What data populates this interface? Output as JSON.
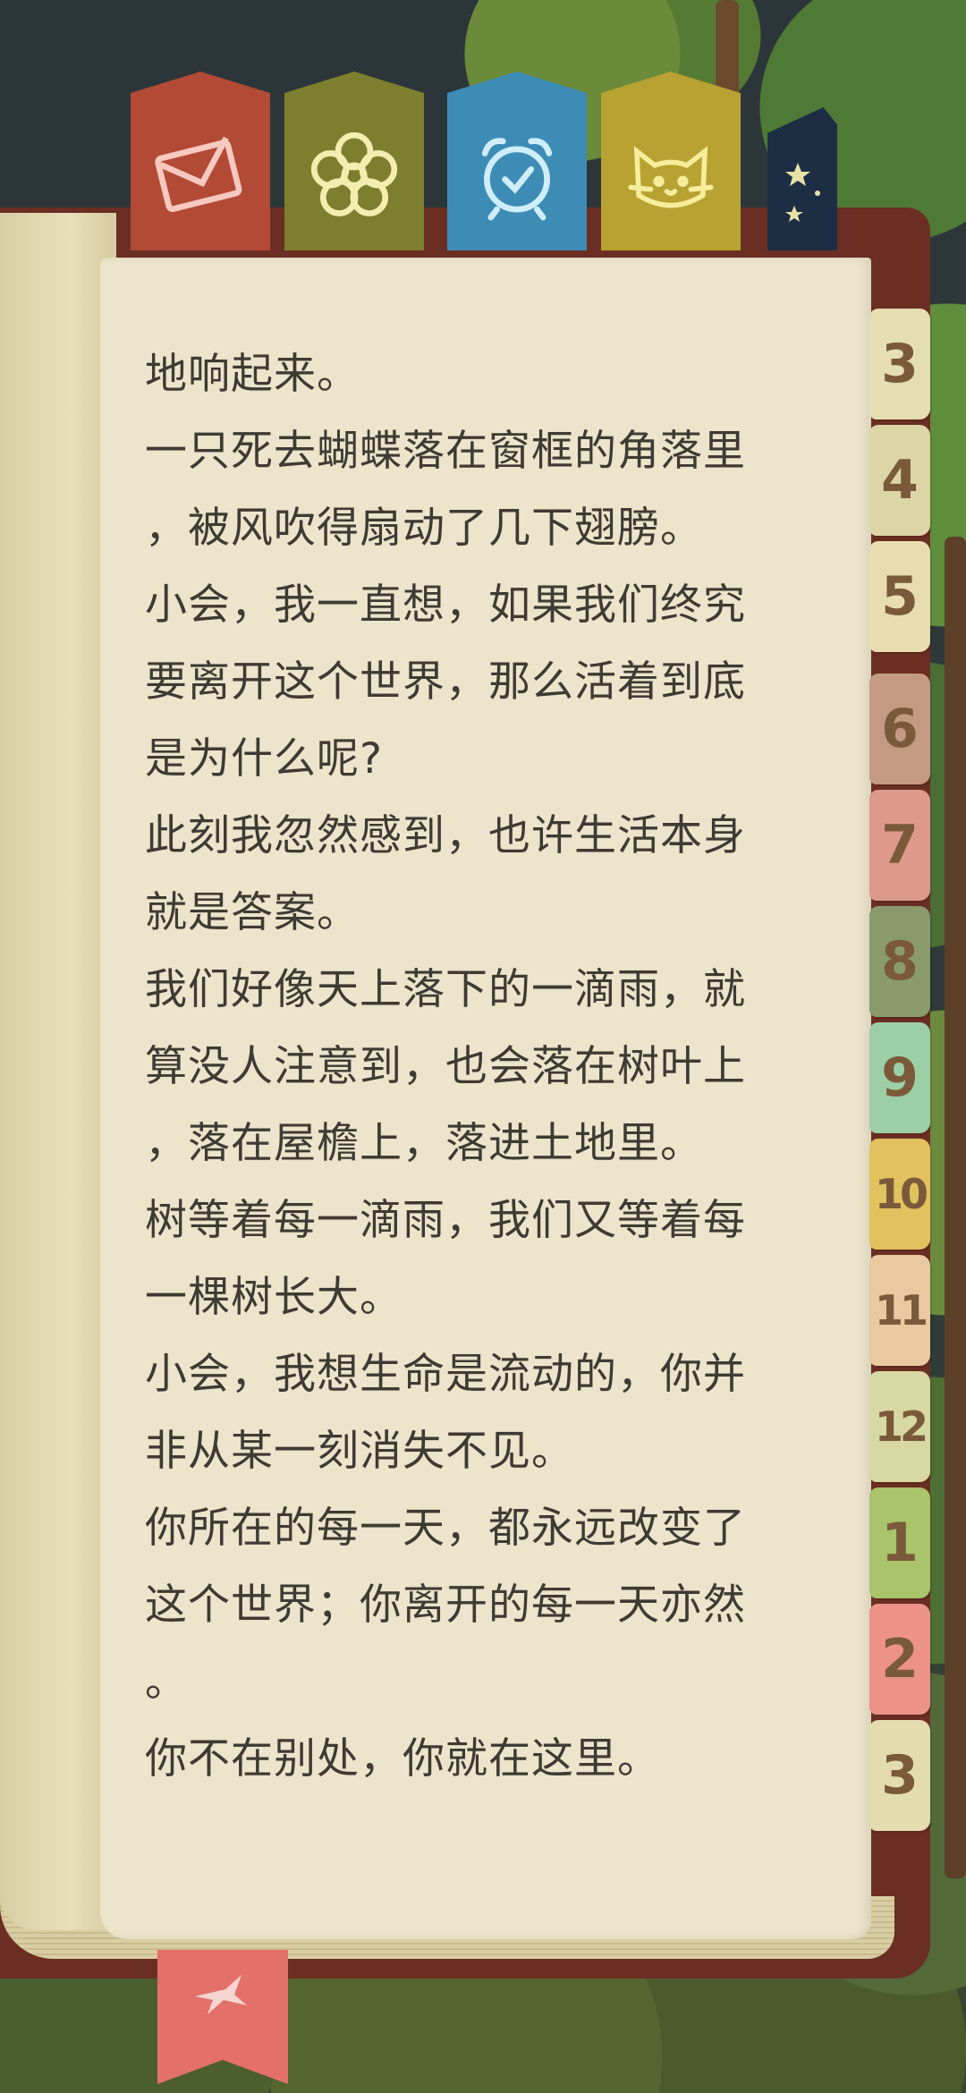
{
  "ribbons": [
    {
      "name": "envelope",
      "icon": "envelope-icon",
      "color": "#b24a35"
    },
    {
      "name": "flower",
      "icon": "flower-icon",
      "color": "#7d7f2e"
    },
    {
      "name": "alarm-clock",
      "icon": "alarm-clock-icon",
      "color": "#3d8cb6"
    },
    {
      "name": "cat",
      "icon": "cat-icon",
      "color": "#b8a232"
    },
    {
      "name": "stars",
      "icon": "stars-icon",
      "color": "#1d2d44"
    }
  ],
  "text_lines": [
    "地响起来。",
    "一只死去蝴蝶落在窗框的角落里",
    "，被风吹得扇动了几下翅膀。",
    "小会，我一直想，如果我们终究",
    "要离开这个世界，那么活着到底",
    "是为什么呢?",
    "此刻我忽然感到，也许生活本身",
    "就是答案。",
    "我们好像天上落下的一滴雨，就",
    "算没人注意到，也会落在树叶上",
    "，落在屋檐上，落进土地里。",
    "树等着每一滴雨，我们又等着每",
    "一棵树长大。",
    "小会，我想生命是流动的，你并",
    "非从某一刻消失不见。",
    "你所在的每一天，都永远改变了",
    "这个世界；你离开的每一天亦然",
    "。",
    "你不在别处，你就在这里。"
  ],
  "chapter_tabs": [
    {
      "label": "3",
      "color": "#e6deb3"
    },
    {
      "label": "4",
      "color": "#dcd6a6"
    },
    {
      "label": "5",
      "color": "#e7ddb1"
    },
    {
      "label": "6",
      "color": "#c39b83"
    },
    {
      "label": "7",
      "color": "#dd9a8a"
    },
    {
      "label": "8",
      "color": "#8a9a6c"
    },
    {
      "label": "9",
      "color": "#9dcfa6"
    },
    {
      "label": "10",
      "color": "#e2c15f"
    },
    {
      "label": "11",
      "color": "#ebc9a0"
    },
    {
      "label": "12",
      "color": "#d8d9a2"
    },
    {
      "label": "1",
      "color": "#a9c46a"
    },
    {
      "label": "2",
      "color": "#ec9289"
    },
    {
      "label": "3",
      "color": "#e3dcae"
    }
  ],
  "bookmark": {
    "icon": "bird-icon",
    "color": "#e4706b"
  }
}
